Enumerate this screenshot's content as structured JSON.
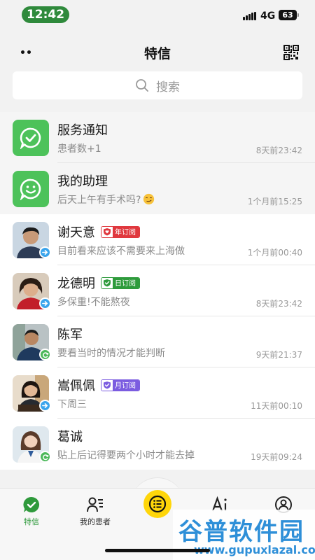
{
  "status": {
    "time": "12:42",
    "network": "4G",
    "battery": "63"
  },
  "header": {
    "title": "特信"
  },
  "search": {
    "placeholder": "搜索"
  },
  "conversations": [
    {
      "name": "服务通知",
      "preview": "患者数+1",
      "time": "8天前23:42",
      "icon": "check-bubble-icon"
    },
    {
      "name": "我的助理",
      "preview": "后天上午有手术吗?",
      "time": "1个月前15:25",
      "icon": "smile-bubble-icon",
      "emoji": "smirk-emoji"
    },
    {
      "name": "谢天意",
      "tag": "年订阅",
      "preview": "目前看来应该不需要来上海做",
      "time": "1个月前00:40",
      "badge": "arrow"
    },
    {
      "name": "龙德明",
      "tag": "日订阅",
      "preview": "多保重!不能熬夜",
      "time": "8天前23:42",
      "badge": "arrow"
    },
    {
      "name": "陈军",
      "preview": "要看当时的情况才能判断",
      "time": "9天前21:37",
      "badge": "cycle"
    },
    {
      "name": "嵩佩佩",
      "tag": "月订阅",
      "preview": "下周三",
      "time": "11天前00:10",
      "badge": "arrow"
    },
    {
      "name": "葛诚",
      "preview": "贴上后记得要两个小时才能去掉",
      "time": "19天前09:24",
      "badge": "cycle"
    }
  ],
  "colors": {
    "tag_year": "#e0383e",
    "tag_day": "#2e9b3c",
    "tag_month": "#7b5ce0",
    "accent": "#4dc25a"
  },
  "tabs": [
    {
      "label": "特信",
      "icon": "chat-check-icon",
      "active": true
    },
    {
      "label": "我的患者",
      "icon": "patients-icon"
    },
    {
      "label": "",
      "icon": "menu-list-icon"
    },
    {
      "label": "",
      "icon": "ai-icon"
    },
    {
      "label": "",
      "icon": "profile-icon"
    }
  ],
  "watermark": {
    "text": "谷普软件园",
    "url": "www.gupuxlazal.com"
  }
}
